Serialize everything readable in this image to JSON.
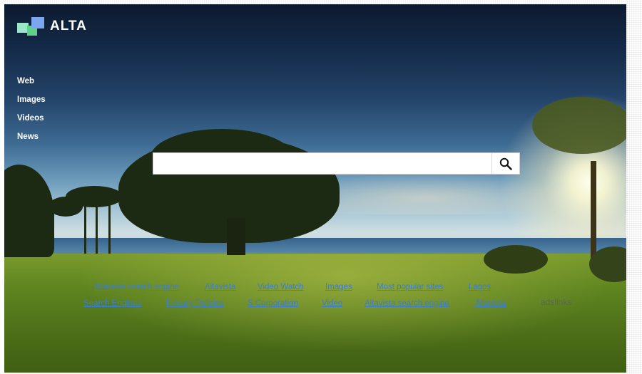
{
  "logo": {
    "text": "ALTA",
    "icon": "alta-logo-mark",
    "colors": [
      "#9be8c8",
      "#5fd18a",
      "#7aa7f0"
    ]
  },
  "nav": {
    "items": [
      {
        "label": "Web"
      },
      {
        "label": "Images"
      },
      {
        "label": "Videos"
      },
      {
        "label": "News"
      }
    ]
  },
  "search": {
    "value": "",
    "placeholder": "",
    "button_icon": "search-icon"
  },
  "links": {
    "row1": [
      "Altavista search engine",
      "Altavista",
      "Video Watch",
      "Images",
      "Most popular sites",
      "Lagos"
    ],
    "row2": [
      "Search Engines",
      "Privacy Policies",
      "S Corporation",
      "Video",
      "Altavista search engine",
      "Altavista"
    ],
    "adslinks": "adslinks"
  },
  "colors": {
    "link": "#3b7fd0",
    "nav_text": "#ffffff"
  }
}
